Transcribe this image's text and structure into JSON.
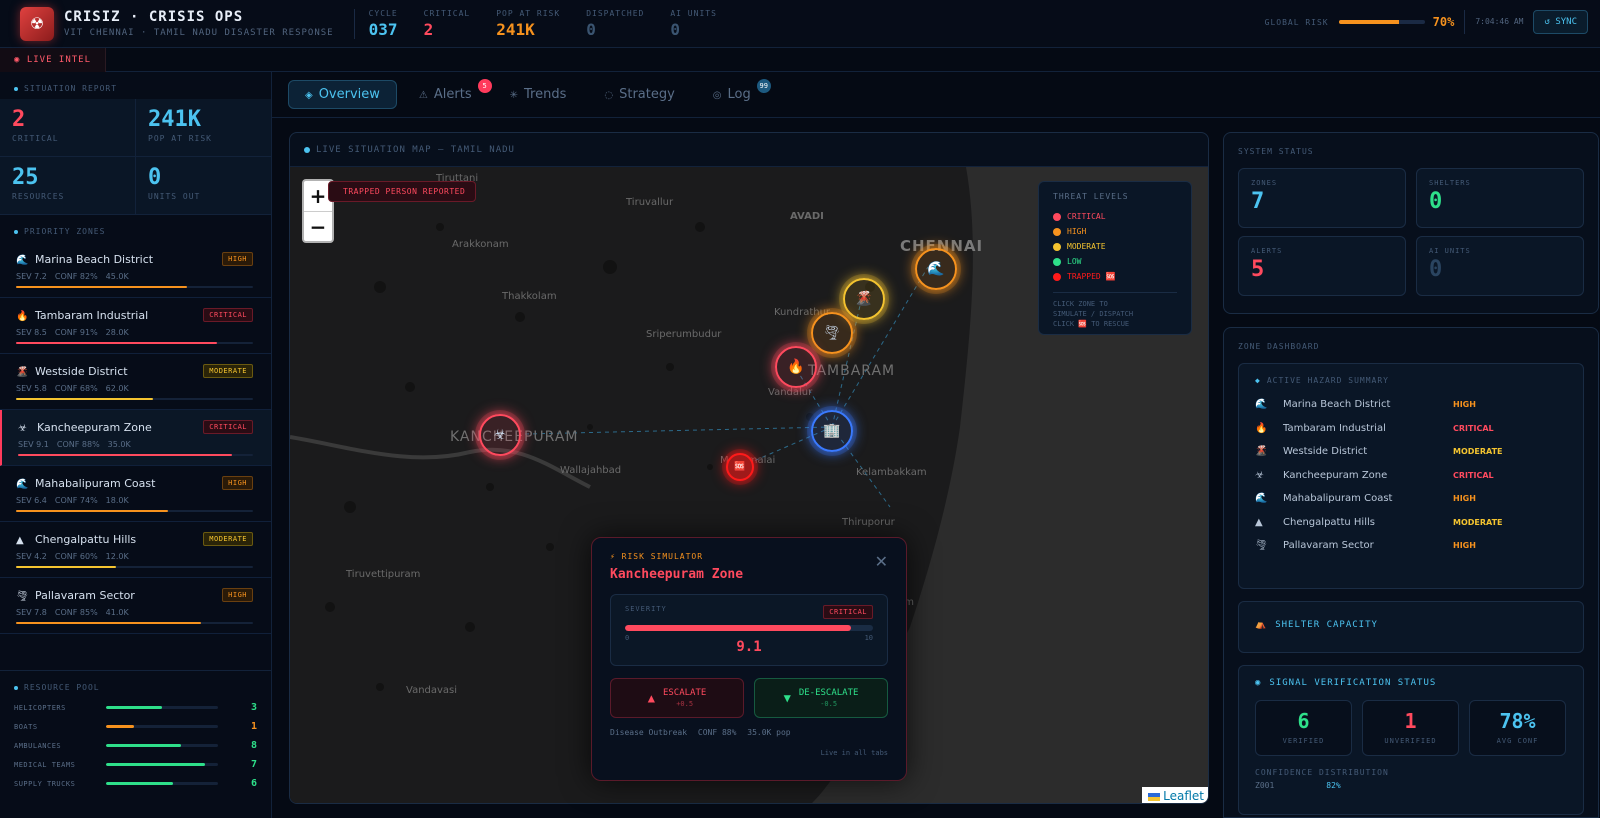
{
  "header": {
    "title": "CRISIZ · CRISIS OPS",
    "subtitle": "VIT CHENNAI · TAMIL NADU DISASTER RESPONSE",
    "stats": [
      {
        "label": "CYCLE",
        "value": "037",
        "color": "#4cc3f0"
      },
      {
        "label": "CRITICAL",
        "value": "2",
        "color": "#ff4a5e"
      },
      {
        "label": "POP AT RISK",
        "value": "241K",
        "color": "#f6921e"
      },
      {
        "label": "DISPATCHED",
        "value": "0",
        "color": "#3a5470"
      },
      {
        "label": "AI UNITS",
        "value": "0",
        "color": "#3a5470"
      }
    ],
    "global_risk_label": "GLOBAL RISK",
    "global_risk_value": "70%",
    "global_risk_fraction": 0.7,
    "clock": "7:04:46 AM",
    "sync_label": "↺ SYNC"
  },
  "live_intel_label": "◉ LIVE INTEL",
  "sidebar": {
    "situation_title": "SITUATION REPORT",
    "situation": [
      {
        "value": "2",
        "label": "CRITICAL",
        "color": "#ff4a5e"
      },
      {
        "value": "241K",
        "label": "POP AT RISK",
        "color": "#4cc3f0"
      },
      {
        "value": "25",
        "label": "RESOURCES",
        "color": "#4cc3f0"
      },
      {
        "value": "0",
        "label": "UNITS OUT",
        "color": "#4cc3f0"
      }
    ],
    "zones_title": "PRIORITY ZONES",
    "zones": [
      {
        "icon": "🌊",
        "icon_name": "wave-icon",
        "name": "Marina Beach District",
        "level": "HIGH",
        "sev": "SEV 7.2",
        "conf": "CONF 82%",
        "pop": "45.0K",
        "fill": 0.72,
        "color": "#f6921e"
      },
      {
        "icon": "🔥",
        "icon_name": "fire-icon",
        "name": "Tambaram Industrial",
        "level": "CRITICAL",
        "sev": "SEV 8.5",
        "conf": "CONF 91%",
        "pop": "28.0K",
        "fill": 0.85,
        "color": "#ff4a5e"
      },
      {
        "icon": "🌋",
        "icon_name": "building-collapse-icon",
        "name": "Westside District",
        "level": "MODERATE",
        "sev": "SEV 5.8",
        "conf": "CONF 68%",
        "pop": "62.0K",
        "fill": 0.58,
        "color": "#f4c430"
      },
      {
        "icon": "☣",
        "icon_name": "biohazard-icon",
        "name": "Kancheepuram Zone",
        "level": "CRITICAL",
        "sev": "SEV 9.1",
        "conf": "CONF 88%",
        "pop": "35.0K",
        "fill": 0.91,
        "color": "#ff4a5e"
      },
      {
        "icon": "🌊",
        "icon_name": "wave-icon",
        "name": "Mahabalipuram Coast",
        "level": "HIGH",
        "sev": "SEV 6.4",
        "conf": "CONF 74%",
        "pop": "18.0K",
        "fill": 0.64,
        "color": "#f6921e"
      },
      {
        "icon": "▲",
        "icon_name": "mountain-icon",
        "name": "Chengalpattu Hills",
        "level": "MODERATE",
        "sev": "SEV 4.2",
        "conf": "CONF 60%",
        "pop": "12.0K",
        "fill": 0.42,
        "color": "#f4c430"
      },
      {
        "icon": "🌪",
        "icon_name": "cyclone-icon",
        "name": "Pallavaram Sector",
        "level": "HIGH",
        "sev": "SEV 7.8",
        "conf": "CONF 85%",
        "pop": "41.0K",
        "fill": 0.78,
        "color": "#f6921e"
      }
    ],
    "resource_title": "RESOURCE POOL",
    "resources": [
      {
        "label": "HELICOPTERS",
        "value": "3",
        "fill": 0.5,
        "color": "#2ee08a"
      },
      {
        "label": "BOATS",
        "value": "1",
        "fill": 0.25,
        "color": "#f6921e"
      },
      {
        "label": "AMBULANCES",
        "value": "8",
        "fill": 0.67,
        "color": "#2ee08a"
      },
      {
        "label": "MEDICAL TEAMS",
        "value": "7",
        "fill": 0.88,
        "color": "#2ee08a"
      },
      {
        "label": "SUPPLY TRUCKS",
        "value": "6",
        "fill": 0.6,
        "color": "#2ee08a"
      }
    ]
  },
  "tabs": [
    {
      "icon": "◈",
      "label": "Overview",
      "active": true,
      "count": ""
    },
    {
      "icon": "⚠",
      "label": "Alerts",
      "active": false,
      "count": "5",
      "count_color": "#ff3b5c"
    },
    {
      "icon": "✳",
      "label": "Trends",
      "active": false,
      "count": ""
    },
    {
      "icon": "◌",
      "label": "Strategy",
      "active": false,
      "count": ""
    },
    {
      "icon": "◎",
      "label": "Log",
      "active": false,
      "count": "99",
      "count_color": "#1d5a80"
    }
  ],
  "map": {
    "title": "LIVE SITUATION MAP — TAMIL NADU",
    "zoom_in": "+",
    "zoom_out": "−",
    "trapped_banner": "TRAPPED PERSON REPORTED",
    "places": [
      "Tiruttani",
      "Tiruvallur",
      "AVADI",
      "CHENNAI",
      "Arakkonam",
      "Thakkolam",
      "Kundrathur",
      "Sriperumbudur",
      "TAMBARAM",
      "Vandalur",
      "KANCHEEPURAM",
      "Wallajahbad",
      "Maraimalai",
      "Kelambakkam",
      "Thiruporur",
      "Tiruvettipuram",
      "Vandavasi",
      "ram"
    ],
    "legend_title": "THREAT LEVELS",
    "legend": [
      {
        "label": "CRITICAL",
        "color": "#ff4a5e"
      },
      {
        "label": "HIGH",
        "color": "#f6921e"
      },
      {
        "label": "MODERATE",
        "color": "#f4c430"
      },
      {
        "label": "LOW",
        "color": "#2ee08a"
      },
      {
        "label": "TRAPPED 🆘",
        "color": "#ff1a1a"
      }
    ],
    "legend_note_1": "CLICK ZONE TO",
    "legend_note_2": "SIMULATE / DISPATCH",
    "legend_note_3": "CLICK 🆘 TO RESCUE",
    "markers": [
      {
        "icon": "🌊",
        "name": "wave-icon",
        "color": "#f6921e"
      },
      {
        "icon": "🌋",
        "name": "building-collapse-icon",
        "color": "#f4c430"
      },
      {
        "icon": "🌪",
        "name": "cyclone-icon",
        "color": "#f6921e"
      },
      {
        "icon": "🔥",
        "name": "fire-icon",
        "color": "#ff4a5e"
      },
      {
        "icon": "🏢",
        "name": "building-icon",
        "color": "#3a7aff"
      },
      {
        "icon": "☣",
        "name": "biohazard-icon",
        "color": "#ff4a5e"
      },
      {
        "icon": "🆘",
        "name": "sos-icon",
        "color": "#ff1a1a"
      }
    ],
    "attribution": "Leaflet"
  },
  "simulator": {
    "title": "⚡ RISK SIMULATOR",
    "zone": "Kancheepuram Zone",
    "close": "✕",
    "severity_label": "SEVERITY",
    "severity_badge": "CRITICAL",
    "severity_min": "0",
    "severity_max": "10",
    "severity_value": "9.1",
    "severity_fraction": 0.91,
    "escalate_label": "ESCALATE",
    "escalate_delta": "+0.5",
    "deescalate_label": "DE-ESCALATE",
    "deescalate_delta": "-0.5",
    "type": "Disease Outbreak",
    "conf": "CONF 88%",
    "pop": "35.0K pop",
    "live_note": "Live in all tabs"
  },
  "system_status": {
    "title": "SYSTEM STATUS",
    "cards": [
      {
        "label": "ZONES",
        "value": "7",
        "color": "#4cc3f0"
      },
      {
        "label": "SHELTERS",
        "value": "0",
        "color": "#2ee08a"
      },
      {
        "label": "ALERTS",
        "value": "5",
        "color": "#ff4a5e"
      },
      {
        "label": "AI UNITS",
        "value": "0",
        "color": "#2a4460"
      }
    ]
  },
  "zone_dashboard": {
    "title": "ZONE DASHBOARD",
    "hazard_title": "ACTIVE HAZARD SUMMARY",
    "hazards": [
      {
        "icon": "🌊",
        "icon_name": "wave-icon",
        "name": "Marina Beach District",
        "level": "HIGH",
        "color": "#f6921e"
      },
      {
        "icon": "🔥",
        "icon_name": "fire-icon",
        "name": "Tambaram Industrial",
        "level": "CRITICAL",
        "color": "#ff4a5e"
      },
      {
        "icon": "🌋",
        "icon_name": "building-collapse-icon",
        "name": "Westside District",
        "level": "MODERATE",
        "color": "#f4c430"
      },
      {
        "icon": "☣",
        "icon_name": "biohazard-icon",
        "name": "Kancheepuram Zone",
        "level": "CRITICAL",
        "color": "#ff4a5e"
      },
      {
        "icon": "🌊",
        "icon_name": "wave-icon",
        "name": "Mahabalipuram Coast",
        "level": "HIGH",
        "color": "#f6921e"
      },
      {
        "icon": "▲",
        "icon_name": "mountain-icon",
        "name": "Chengalpattu Hills",
        "level": "MODERATE",
        "color": "#f4c430"
      },
      {
        "icon": "🌪",
        "icon_name": "cyclone-icon",
        "name": "Pallavaram Sector",
        "level": "HIGH",
        "color": "#f6921e"
      }
    ],
    "shelter_title": "SHELTER CAPACITY",
    "signal_title": "SIGNAL VERIFICATION STATUS",
    "signal": [
      {
        "value": "6",
        "label": "VERIFIED",
        "color": "#2ee08a"
      },
      {
        "value": "1",
        "label": "UNVERIFIED",
        "color": "#ff4a5e"
      },
      {
        "value": "78%",
        "label": "AVG CONF",
        "color": "#4cc3f0"
      }
    ],
    "confidence_title": "CONFIDENCE DISTRIBUTION",
    "confidence_row_label": "Z001",
    "confidence_row_value": "82%"
  }
}
